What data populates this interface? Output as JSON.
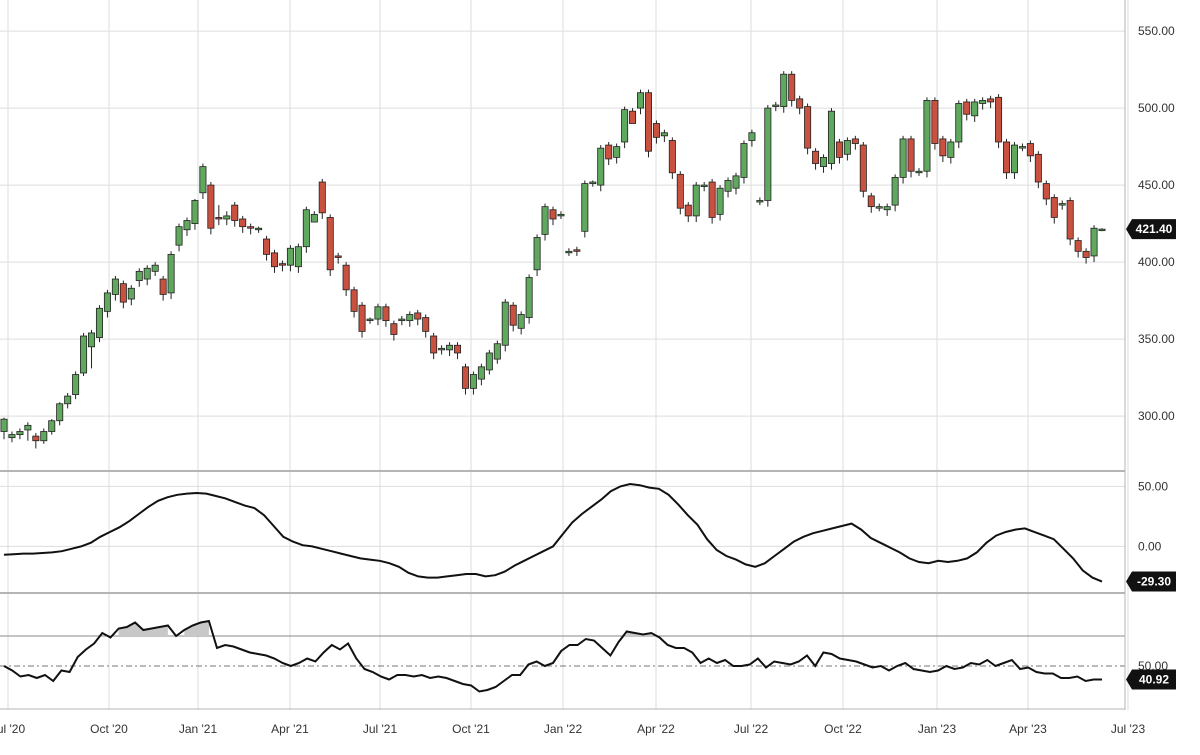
{
  "colors": {
    "up": "#5fa85e",
    "down": "#c9513f",
    "line": "#111111",
    "grid": "#dddddd",
    "separator": "#b5b5b5",
    "area": "#c8c8c8",
    "tag_bg": "#111111"
  },
  "chart_data": [
    {
      "type": "candlestick",
      "panel": "price",
      "ylim": [
        265,
        565
      ],
      "yticks": [
        "550.00",
        "500.00",
        "450.00",
        "400.00",
        "350.00",
        "300.00"
      ],
      "last_value_label": "421.40",
      "last_value": 421.4,
      "candles": [
        [
          290,
          298,
          287,
          285,
          299
        ],
        [
          286,
          288,
          284,
          283,
          290
        ],
        [
          288,
          290,
          286,
          285,
          292
        ],
        [
          291,
          294,
          286,
          284,
          296
        ],
        [
          287,
          284,
          280,
          279,
          289
        ],
        [
          284,
          290,
          283,
          282,
          292
        ],
        [
          290,
          297,
          289,
          288,
          298
        ],
        [
          297,
          308,
          296,
          294,
          309
        ],
        [
          308,
          313,
          306,
          305,
          315
        ],
        [
          314,
          327,
          312,
          311,
          329
        ],
        [
          328,
          352,
          327,
          326,
          354
        ],
        [
          345,
          354,
          333,
          331,
          356
        ],
        [
          351,
          370,
          350,
          348,
          372
        ],
        [
          368,
          380,
          366,
          364,
          382
        ],
        [
          379,
          389,
          377,
          375,
          391
        ],
        [
          386,
          374,
          372,
          370,
          388
        ],
        [
          376,
          383,
          374,
          372,
          385
        ],
        [
          388,
          394,
          386,
          384,
          396
        ],
        [
          389,
          396,
          387,
          385,
          398
        ],
        [
          394,
          398,
          393,
          391,
          400
        ],
        [
          389,
          379,
          377,
          375,
          391
        ],
        [
          380,
          405,
          378,
          376,
          407
        ],
        [
          411,
          423,
          409,
          407,
          425
        ],
        [
          421,
          427,
          419,
          417,
          429
        ],
        [
          425,
          440,
          423,
          421,
          441
        ],
        [
          445,
          462,
          443,
          441,
          464
        ],
        [
          450,
          422,
          420,
          418,
          452
        ],
        [
          429,
          428,
          426,
          424,
          437
        ],
        [
          428,
          430,
          426,
          424,
          433
        ],
        [
          437,
          427,
          425,
          423,
          439
        ],
        [
          428,
          423,
          421,
          419,
          430
        ],
        [
          423,
          422,
          420,
          418,
          425
        ],
        [
          422,
          422,
          420,
          419,
          423
        ],
        [
          415,
          405,
          403,
          401,
          417
        ],
        [
          406,
          397,
          395,
          393,
          408
        ],
        [
          399,
          398,
          396,
          394,
          401
        ],
        [
          398,
          409,
          396,
          394,
          411
        ],
        [
          397,
          410,
          395,
          393,
          412
        ],
        [
          410,
          434,
          408,
          406,
          436
        ],
        [
          426,
          431,
          429,
          427,
          433
        ],
        [
          452,
          432,
          430,
          428,
          454
        ],
        [
          429,
          395,
          393,
          391,
          431
        ],
        [
          404,
          403,
          401,
          399,
          406
        ],
        [
          398,
          382,
          380,
          378,
          400
        ],
        [
          382,
          368,
          366,
          364,
          384
        ],
        [
          372,
          355,
          353,
          351,
          374
        ],
        [
          362,
          363,
          361,
          360,
          364
        ],
        [
          363,
          371,
          361,
          359,
          373
        ],
        [
          371,
          362,
          360,
          358,
          373
        ],
        [
          360,
          353,
          351,
          349,
          362
        ],
        [
          362,
          363,
          361,
          359,
          365
        ],
        [
          362,
          366,
          360,
          358,
          368
        ],
        [
          367,
          363,
          361,
          359,
          369
        ],
        [
          364,
          355,
          353,
          351,
          366
        ],
        [
          352,
          341,
          339,
          337,
          354
        ],
        [
          343,
          344,
          342,
          340,
          346
        ],
        [
          343,
          346,
          341,
          339,
          348
        ],
        [
          346,
          341,
          339,
          337,
          348
        ],
        [
          332,
          318,
          316,
          314,
          334
        ],
        [
          318,
          327,
          316,
          314,
          329
        ],
        [
          324,
          332,
          322,
          320,
          334
        ],
        [
          330,
          341,
          329,
          327,
          343
        ],
        [
          337,
          347,
          336,
          334,
          349
        ],
        [
          346,
          374,
          344,
          342,
          376
        ],
        [
          372,
          359,
          357,
          355,
          374
        ],
        [
          357,
          366,
          355,
          353,
          368
        ],
        [
          364,
          390,
          362,
          360,
          392
        ],
        [
          395,
          416,
          393,
          391,
          418
        ],
        [
          418,
          436,
          416,
          414,
          438
        ],
        [
          434,
          428,
          426,
          424,
          436
        ],
        [
          431,
          431,
          429,
          428,
          433
        ],
        [
          407,
          407,
          405,
          404,
          409
        ],
        [
          408,
          407,
          405,
          404,
          410
        ],
        [
          420,
          451,
          418,
          416,
          453
        ],
        [
          451,
          452,
          450,
          449,
          453
        ],
        [
          450,
          474,
          448,
          446,
          476
        ],
        [
          476,
          467,
          465,
          463,
          478
        ],
        [
          468,
          475,
          466,
          464,
          477
        ],
        [
          478,
          499,
          476,
          474,
          501
        ],
        [
          498,
          490,
          496,
          494,
          500
        ],
        [
          500,
          510,
          498,
          496,
          512
        ],
        [
          510,
          472,
          470,
          468,
          512
        ],
        [
          490,
          481,
          479,
          477,
          492
        ],
        [
          482,
          484,
          480,
          478,
          486
        ],
        [
          479,
          458,
          456,
          454,
          481
        ],
        [
          457,
          435,
          433,
          431,
          459
        ],
        [
          437,
          430,
          428,
          426,
          439
        ],
        [
          430,
          450,
          428,
          426,
          452
        ],
        [
          450,
          450,
          448,
          446,
          452
        ],
        [
          452,
          429,
          427,
          425,
          454
        ],
        [
          431,
          448,
          429,
          427,
          450
        ],
        [
          446,
          453,
          444,
          442,
          455
        ],
        [
          448,
          456,
          446,
          444,
          458
        ],
        [
          455,
          477,
          453,
          451,
          479
        ],
        [
          479,
          484,
          477,
          475,
          486
        ],
        [
          440,
          440,
          438,
          437,
          442
        ],
        [
          440,
          500,
          438,
          436,
          502
        ],
        [
          502,
          502,
          500,
          498,
          504
        ],
        [
          501,
          522,
          499,
          497,
          524
        ],
        [
          522,
          505,
          503,
          501,
          524
        ],
        [
          506,
          500,
          498,
          496,
          508
        ],
        [
          501,
          474,
          472,
          470,
          503
        ],
        [
          472,
          464,
          462,
          460,
          474
        ],
        [
          462,
          468,
          460,
          458,
          470
        ],
        [
          464,
          498,
          462,
          460,
          500
        ],
        [
          478,
          468,
          466,
          464,
          480
        ],
        [
          470,
          479,
          468,
          466,
          481
        ],
        [
          480,
          477,
          475,
          473,
          482
        ],
        [
          476,
          446,
          444,
          442,
          478
        ],
        [
          443,
          436,
          434,
          432,
          445
        ],
        [
          436,
          436,
          434,
          433,
          438
        ],
        [
          434,
          436,
          432,
          430,
          438
        ],
        [
          437,
          455,
          435,
          433,
          457
        ],
        [
          455,
          480,
          453,
          451,
          482
        ],
        [
          480,
          459,
          457,
          455,
          482
        ],
        [
          459,
          459,
          457,
          456,
          461
        ],
        [
          459,
          505,
          457,
          455,
          507
        ],
        [
          505,
          477,
          475,
          473,
          507
        ],
        [
          480,
          469,
          467,
          465,
          482
        ],
        [
          468,
          478,
          466,
          464,
          480
        ],
        [
          478,
          503,
          476,
          474,
          505
        ],
        [
          504,
          496,
          494,
          492,
          506
        ],
        [
          495,
          504,
          493,
          491,
          506
        ],
        [
          503,
          505,
          501,
          499,
          507
        ],
        [
          506,
          504,
          502,
          500,
          508
        ],
        [
          507,
          478,
          476,
          474,
          509
        ],
        [
          478,
          458,
          456,
          454,
          480
        ],
        [
          458,
          476,
          456,
          454,
          478
        ],
        [
          475,
          475,
          473,
          472,
          477
        ],
        [
          477,
          469,
          467,
          465,
          479
        ],
        [
          470,
          452,
          450,
          448,
          472
        ],
        [
          451,
          441,
          439,
          437,
          453
        ],
        [
          442,
          429,
          427,
          425,
          444
        ],
        [
          438,
          438,
          436,
          434,
          440
        ],
        [
          440,
          415,
          413,
          411,
          442
        ],
        [
          414,
          407,
          405,
          403,
          416
        ],
        [
          407,
          403,
          401,
          399,
          409
        ],
        [
          404,
          422,
          402,
          400,
          424
        ],
        [
          421.4,
          421.4,
          420,
          420,
          422
        ]
      ]
    },
    {
      "type": "line",
      "panel": "oscillator",
      "ylim": [
        -38,
        62
      ],
      "yticks": [
        "50.00",
        "0.00"
      ],
      "last_value_label": "-29.30",
      "values": [
        -7,
        -6.5,
        -6,
        -6,
        -5.5,
        -5,
        -4,
        -2,
        0,
        3,
        8,
        12,
        16,
        21,
        27,
        33,
        38,
        41,
        43,
        44,
        44.5,
        44,
        42,
        40,
        37,
        34,
        32,
        26,
        17,
        8,
        4,
        1,
        0,
        -2,
        -4,
        -6,
        -8,
        -10,
        -11,
        -12,
        -14,
        -17,
        -22,
        -25,
        -26,
        -26,
        -25,
        -24,
        -23,
        -23,
        -25,
        -24,
        -21,
        -16,
        -12,
        -8,
        -4,
        0,
        10,
        20,
        27,
        33,
        39,
        46,
        50,
        52,
        51,
        49,
        48,
        43,
        35,
        26,
        18,
        6,
        -3,
        -8,
        -11,
        -15,
        -17,
        -14,
        -8,
        -2,
        4,
        8,
        11,
        13,
        15,
        17,
        19,
        14,
        7,
        3,
        -1,
        -5,
        -10,
        -13,
        -14,
        -12,
        -13,
        -12,
        -10,
        -5,
        3,
        9,
        12,
        14,
        15,
        12,
        9,
        6,
        -2,
        -10,
        -20,
        -26,
        -29.3
      ]
    },
    {
      "type": "area",
      "panel": "rsi",
      "ylim": [
        22,
        98
      ],
      "yticks": [
        "50.00"
      ],
      "upper_band": 70,
      "mid_line": 50,
      "last_value_label": "40.92",
      "values": [
        50,
        47,
        43,
        44,
        42,
        44,
        40,
        47,
        46,
        56,
        61,
        65,
        72,
        69,
        75,
        76,
        79,
        74,
        75,
        76,
        77,
        70,
        74,
        77,
        79,
        80,
        62,
        64,
        63,
        61,
        59,
        58,
        57,
        55,
        52,
        50,
        52,
        55,
        53,
        59,
        64,
        61,
        65,
        55,
        48,
        46,
        43,
        41,
        44,
        44,
        43,
        44,
        42,
        43,
        42,
        40,
        38,
        37,
        33,
        34,
        36,
        40,
        44,
        44,
        51,
        53,
        50,
        52,
        60,
        64,
        64,
        68,
        67,
        62,
        57,
        66,
        73,
        72,
        71,
        72,
        69,
        64,
        62,
        62,
        59,
        52,
        55,
        52,
        54,
        50,
        50,
        51,
        55,
        49,
        53,
        52,
        51,
        53,
        57,
        50,
        59,
        58,
        55,
        54,
        53,
        51,
        49,
        50,
        47,
        50,
        52,
        48,
        47,
        46,
        47,
        50,
        48,
        49,
        52,
        51,
        54,
        50,
        52,
        54,
        48,
        49,
        46,
        45,
        45,
        42,
        42,
        43,
        40,
        41,
        41
      ],
      "overbought_fill": true
    }
  ],
  "x_axis": {
    "labels": [
      "Jul '20",
      "Oct '20",
      "Jan '21",
      "Apr '21",
      "Jul '21",
      "Oct '21",
      "Jan '22",
      "Apr '22",
      "Jul '22",
      "Oct '22",
      "Jan '23",
      "Apr '23",
      "Jul '23"
    ]
  }
}
